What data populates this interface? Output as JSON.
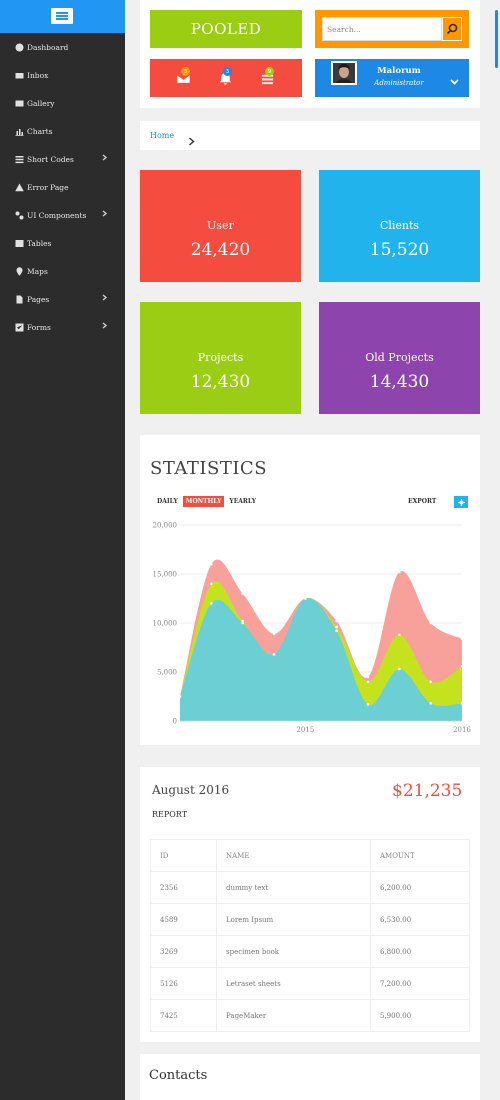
{
  "sidebar": {
    "items": [
      {
        "label": "Dashboard",
        "icon": "dashboard-icon",
        "has_submenu": false
      },
      {
        "label": "Inbox",
        "icon": "envelope-icon",
        "has_submenu": false
      },
      {
        "label": "Gallery",
        "icon": "picture-icon",
        "has_submenu": false
      },
      {
        "label": "Charts",
        "icon": "bar-chart-icon",
        "has_submenu": false
      },
      {
        "label": "Short Codes",
        "icon": "list-icon",
        "has_submenu": true
      },
      {
        "label": "Error Page",
        "icon": "warning-icon",
        "has_submenu": false
      },
      {
        "label": "UI Components",
        "icon": "cogs-icon",
        "has_submenu": true
      },
      {
        "label": "Tables",
        "icon": "table-icon",
        "has_submenu": false
      },
      {
        "label": "Maps",
        "icon": "map-marker-icon",
        "has_submenu": false
      },
      {
        "label": "Pages",
        "icon": "file-icon",
        "has_submenu": true
      },
      {
        "label": "Forms",
        "icon": "checkbox-icon",
        "has_submenu": true
      }
    ]
  },
  "header": {
    "logo": "POOLED",
    "search": {
      "placeholder": "Search...",
      "value": ""
    },
    "notifications": [
      {
        "icon": "envelope-icon",
        "count": "3",
        "color": "#ff9800"
      },
      {
        "icon": "bell-icon",
        "count": "3",
        "color": "#1e88e5"
      },
      {
        "icon": "tasks-icon",
        "count": "9",
        "color": "#9acd14"
      }
    ],
    "profile": {
      "name": "Malorum",
      "role": "Administrator"
    }
  },
  "breadcrumb": {
    "home": "Home"
  },
  "tiles": {
    "user": {
      "label": "User",
      "value": "24,420"
    },
    "clients": {
      "label": "Clients",
      "value": "15,520"
    },
    "projects": {
      "label": "Projects",
      "value": "12,430"
    },
    "old_projects": {
      "label": "Old Projects",
      "value": "14,430"
    }
  },
  "statistics": {
    "title": "STATISTICS",
    "tabs": [
      "DAILY",
      "MONTHLY",
      "YEARLY"
    ],
    "active_tab": "MONTHLY",
    "export_label": "EXPORT"
  },
  "chart_data": {
    "type": "area",
    "stacked": true,
    "grid": true,
    "ylim": [
      0,
      20000
    ],
    "yticks": [
      0,
      5000,
      10000,
      15000,
      20000
    ],
    "ytick_labels": [
      "0",
      "5,000",
      "10,000",
      "15,000",
      "20,000"
    ],
    "xtick_labels": [
      {
        "label": "2015",
        "index": 4
      },
      {
        "label": "2016",
        "index": 9
      }
    ],
    "series": [
      {
        "color": "#6ccfd3",
        "values": [
          2500,
          12000,
          10000,
          6800,
          12500,
          9200,
          1700,
          5300,
          1800,
          1800
        ]
      },
      {
        "color": "#c5e21f",
        "values": [
          2500,
          14000,
          10200,
          6800,
          12500,
          9600,
          4000,
          8800,
          4000,
          5600
        ]
      },
      {
        "color": "#f7a19a",
        "values": [
          2500,
          16000,
          13000,
          8900,
          12500,
          10200,
          4500,
          15200,
          10000,
          8400
        ]
      }
    ]
  },
  "report": {
    "month": "August 2016",
    "total": "$21,235",
    "label": "REPORT",
    "columns": [
      "ID",
      "NAME",
      "AMOUNT"
    ],
    "rows": [
      [
        "2356",
        "dummy text",
        "6,200.00"
      ],
      [
        "4589",
        "Lorem Ipsum",
        "6,530.00"
      ],
      [
        "3269",
        "specimen book",
        "6,800.00"
      ],
      [
        "5126",
        "Letraset sheets",
        "7,200.00"
      ],
      [
        "7425",
        "PageMaker",
        "5,900.00"
      ]
    ]
  },
  "contacts": {
    "title": "Contacts"
  }
}
